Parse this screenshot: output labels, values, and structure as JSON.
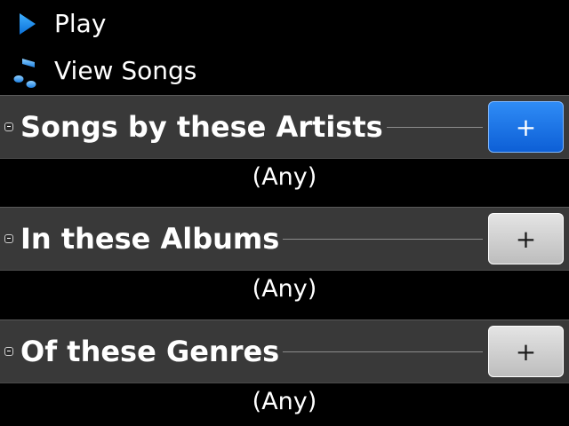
{
  "menu": {
    "play_label": "Play",
    "view_songs_label": "View Songs"
  },
  "icons": {
    "play": "play-icon",
    "music": "music-note-icon",
    "collapse": "collapse-icon"
  },
  "colors": {
    "accent": "#1a6ee8",
    "header_bg": "#393939",
    "background": "#000000"
  },
  "sections": [
    {
      "title": "Songs by these Artists",
      "button_label": "+",
      "button_active": true,
      "value": "(Any)"
    },
    {
      "title": "In these Albums",
      "button_label": "+",
      "button_active": false,
      "value": "(Any)"
    },
    {
      "title": "Of these Genres",
      "button_label": "+",
      "button_active": false,
      "value": "(Any)"
    }
  ]
}
